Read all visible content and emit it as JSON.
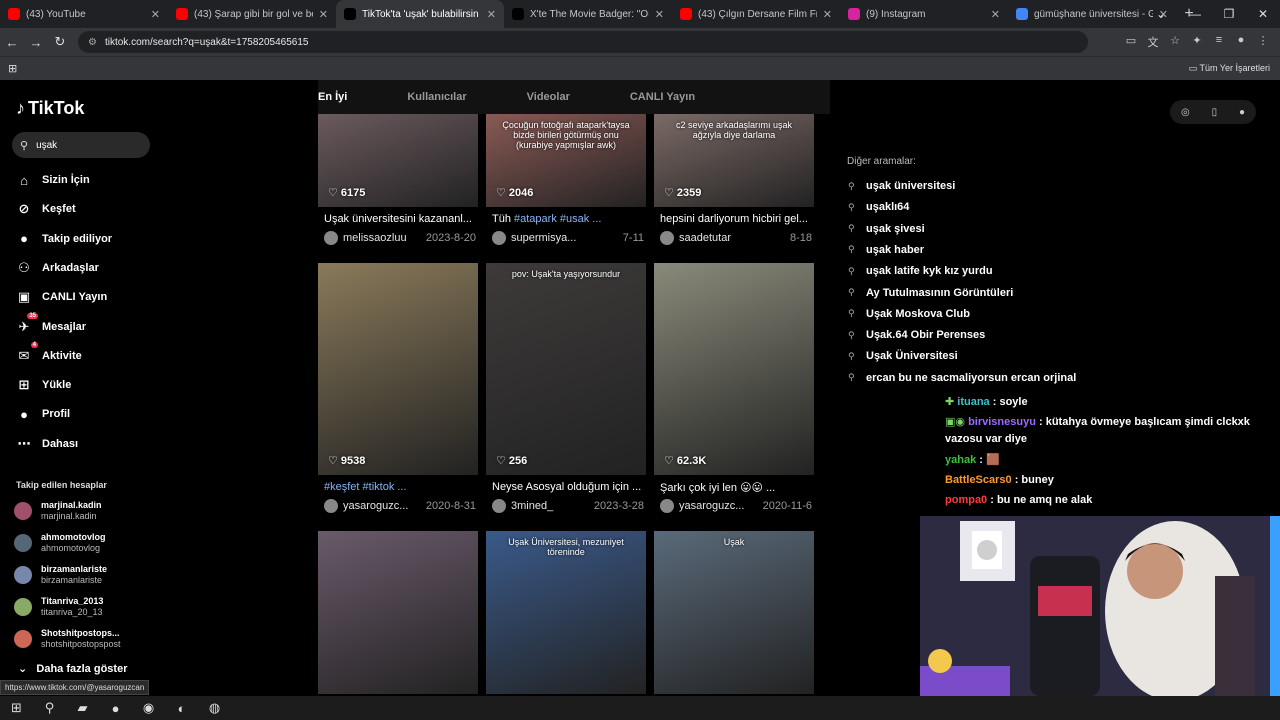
{
  "browser": {
    "tabs": [
      {
        "title": "(43) YouTube",
        "color": "#ff0000"
      },
      {
        "title": "(43) Şarap gibi bir gol ve ben bu",
        "color": "#ff0000"
      },
      {
        "title": "TikTok'ta 'uşak' bulabilirsin",
        "color": "#000000"
      },
      {
        "title": "X'te The Movie Badger: \"ONE B",
        "color": "#000000"
      },
      {
        "title": "(43) Çılgın Dersane Film Fragm",
        "color": "#ff0000"
      },
      {
        "title": "(9) Instagram",
        "color": "#d6249f"
      },
      {
        "title": "gümüşhane üniversitesi - Goog",
        "color": "#4285f4"
      }
    ],
    "url": "tiktok.com/search?q=uşak&t=1758205465615",
    "bookmarks_label": "Tüm Yer İşaretleri"
  },
  "sidebar": {
    "logo": "TikTok",
    "search_value": "uşak",
    "nav": [
      {
        "label": "Sizin İçin",
        "icon": "home-icon",
        "badge": ""
      },
      {
        "label": "Keşfet",
        "icon": "compass-icon",
        "badge": ""
      },
      {
        "label": "Takip ediliyor",
        "icon": "following-avatar-icon",
        "badge": ""
      },
      {
        "label": "Arkadaşlar",
        "icon": "friends-icon",
        "badge": ""
      },
      {
        "label": "CANLI Yayın",
        "icon": "live-icon",
        "badge": ""
      },
      {
        "label": "Mesajlar",
        "icon": "messages-icon",
        "badge": "35"
      },
      {
        "label": "Aktivite",
        "icon": "activity-icon",
        "badge": "4"
      },
      {
        "label": "Yükle",
        "icon": "upload-icon",
        "badge": ""
      },
      {
        "label": "Profil",
        "icon": "profile-icon",
        "badge": ""
      },
      {
        "label": "Dahası",
        "icon": "more-icon",
        "badge": ""
      }
    ],
    "following_title": "Takip edilen hesaplar",
    "following": [
      {
        "name": "marjinal.kadin",
        "handle": "marjinal.kadin",
        "color": "#a0506a"
      },
      {
        "name": "ahmomotovlog",
        "handle": "ahmomotovlog",
        "color": "#556677"
      },
      {
        "name": "birzamanlariste",
        "handle": "birzamanlariste",
        "color": "#7788aa"
      },
      {
        "name": "Titanriva_2013",
        "handle": "titanriva_20_13",
        "color": "#88aa66"
      },
      {
        "name": "Shotshitpostops...",
        "handle": "shotshitpostopspost",
        "color": "#cc6655"
      }
    ],
    "more_label": "Daha fazla göster",
    "status_url": "https://www.tiktok.com/@yasaroguzcan"
  },
  "tabs": [
    "En İyi",
    "Kullanıcılar",
    "Videolar",
    "CANLI Yayın"
  ],
  "videos": [
    {
      "likes": "6175",
      "caption": "Uşak üniversitesini kazananl...",
      "tags": "",
      "user": "melissaozluu",
      "date": "2023-8-20",
      "overlay": "",
      "bg": "#6b5a5e"
    },
    {
      "likes": "2046",
      "caption": "Tüh ",
      "tags": "#atapark #usak ...",
      "user": "supermisya...",
      "date": "7-11",
      "overlay": "Çocuğun fotoğrafı atapark'taysa bizde birileri götürmüş onu (kurabiye yapmışlar awk)",
      "bg": "#8a5a55"
    },
    {
      "likes": "2359",
      "caption": "hepsini darliyorum hicbiri gel...",
      "tags": "",
      "user": "saadetutar",
      "date": "8-18",
      "overlay": "c2 seviye arkadaşlarımı uşak ağzıyla diye darlama",
      "bg": "#7b6a66"
    },
    {
      "likes": "9538",
      "caption": "",
      "tags": "#keşfet #tiktok ...",
      "user": "yasaroguzc...",
      "date": "2020-8-31",
      "overlay": "",
      "bg": "#8a7a5a"
    },
    {
      "likes": "256",
      "caption": "Neyse Asosyal olduğum için ...",
      "tags": "",
      "user": "3mined_",
      "date": "2023-3-28",
      "overlay": "pov: Uşak'ta yaşıyorsundur",
      "bg": "#3e3a3a"
    },
    {
      "likes": "62.3K",
      "caption": "Şarkı çok iyi len 😛😛 ...",
      "tags": "",
      "user": "yasaroguzc...",
      "date": "2020-11-6",
      "overlay": "",
      "bg": "#8a8a7a"
    },
    {
      "likes": "",
      "caption": "",
      "tags": "",
      "user": "",
      "date": "",
      "overlay": "",
      "bg": "#6a5a6a"
    },
    {
      "likes": "",
      "caption": "",
      "tags": "",
      "user": "",
      "date": "",
      "overlay": "Uşak Üniversitesi, mezuniyet töreninde",
      "bg": "#3a5a8a"
    },
    {
      "likes": "",
      "caption": "",
      "tags": "",
      "user": "",
      "date": "",
      "overlay": "Uşak",
      "bg": "#5a6a7a"
    }
  ],
  "right": {
    "other_title": "Diğer aramalar:",
    "suggestions": [
      "uşak üniversitesi",
      "uşaklı64",
      "uşak şivesi",
      "uşak haber",
      "uşak latife kyk kız yurdu",
      "Ay Tutulmasının Görüntüleri",
      "Uşak Moskova Club",
      "Uşak.64 Obir Perenses",
      "Uşak Üniversitesi",
      "ercan bu ne sacmaliyorsun ercan orjinal"
    ]
  },
  "chat": [
    {
      "user": "ituana",
      "color": "#3ac1c9",
      "text": " : soyle",
      "prefix": "✚ "
    },
    {
      "user": "birvisnesuyu",
      "color": "#9b6bff",
      "text": " : kütahya övmeye başlıcam şimdi clckxk vazosu var diye",
      "prefix": "▣◉ "
    },
    {
      "user": "yahak",
      "color": "#3ac13a",
      "text": " : 🟫",
      "prefix": ""
    },
    {
      "user": "BattleScars0",
      "color": "#ff9a2e",
      "text": " : buney",
      "prefix": ""
    },
    {
      "user": "pompa0",
      "color": "#ff3b3b",
      "text": " : bu ne amq ne alak",
      "prefix": ""
    }
  ]
}
